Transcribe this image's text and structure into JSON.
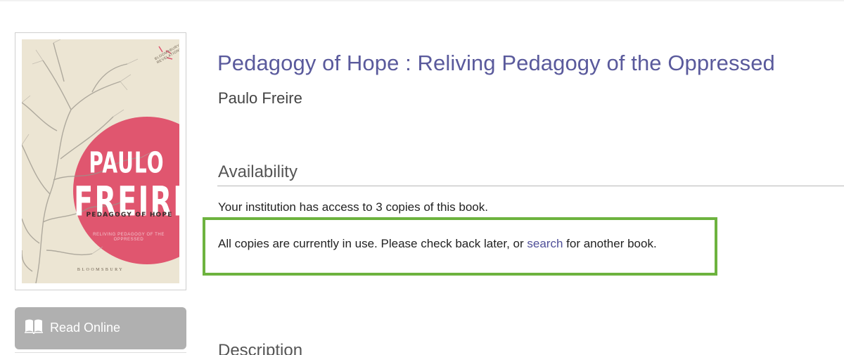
{
  "book": {
    "title": "Pedagogy of Hope : Reliving Pedagogy of the Oppressed",
    "author": "Paulo Freire"
  },
  "cover": {
    "series_line1": "Bloomsbury",
    "series_line2": "Revelations",
    "author_first": "PAULO",
    "author_last": "FREIRE",
    "title": "PEDAGOGY OF HOPE",
    "subtitle": "Reliving Pedagogy of the Oppressed",
    "publisher": "Bloomsbury",
    "circle_color": "#e0566f",
    "background_color": "#ece5d3"
  },
  "actions": {
    "read_online_label": "Read Online",
    "read_online_icon": "book-open-icon"
  },
  "availability": {
    "heading": "Availability",
    "access_text": "Your institution has access to 3 copies of this book.",
    "notice_before": "All copies are currently in use. Please check back later, or ",
    "notice_link": "search",
    "notice_after": " for another book.",
    "highlight_color": "#6db33f"
  },
  "description": {
    "heading": "Description"
  },
  "colors": {
    "title": "#5a5a9c",
    "link": "#4f4f98",
    "button_bg": "#b0b0b0"
  }
}
